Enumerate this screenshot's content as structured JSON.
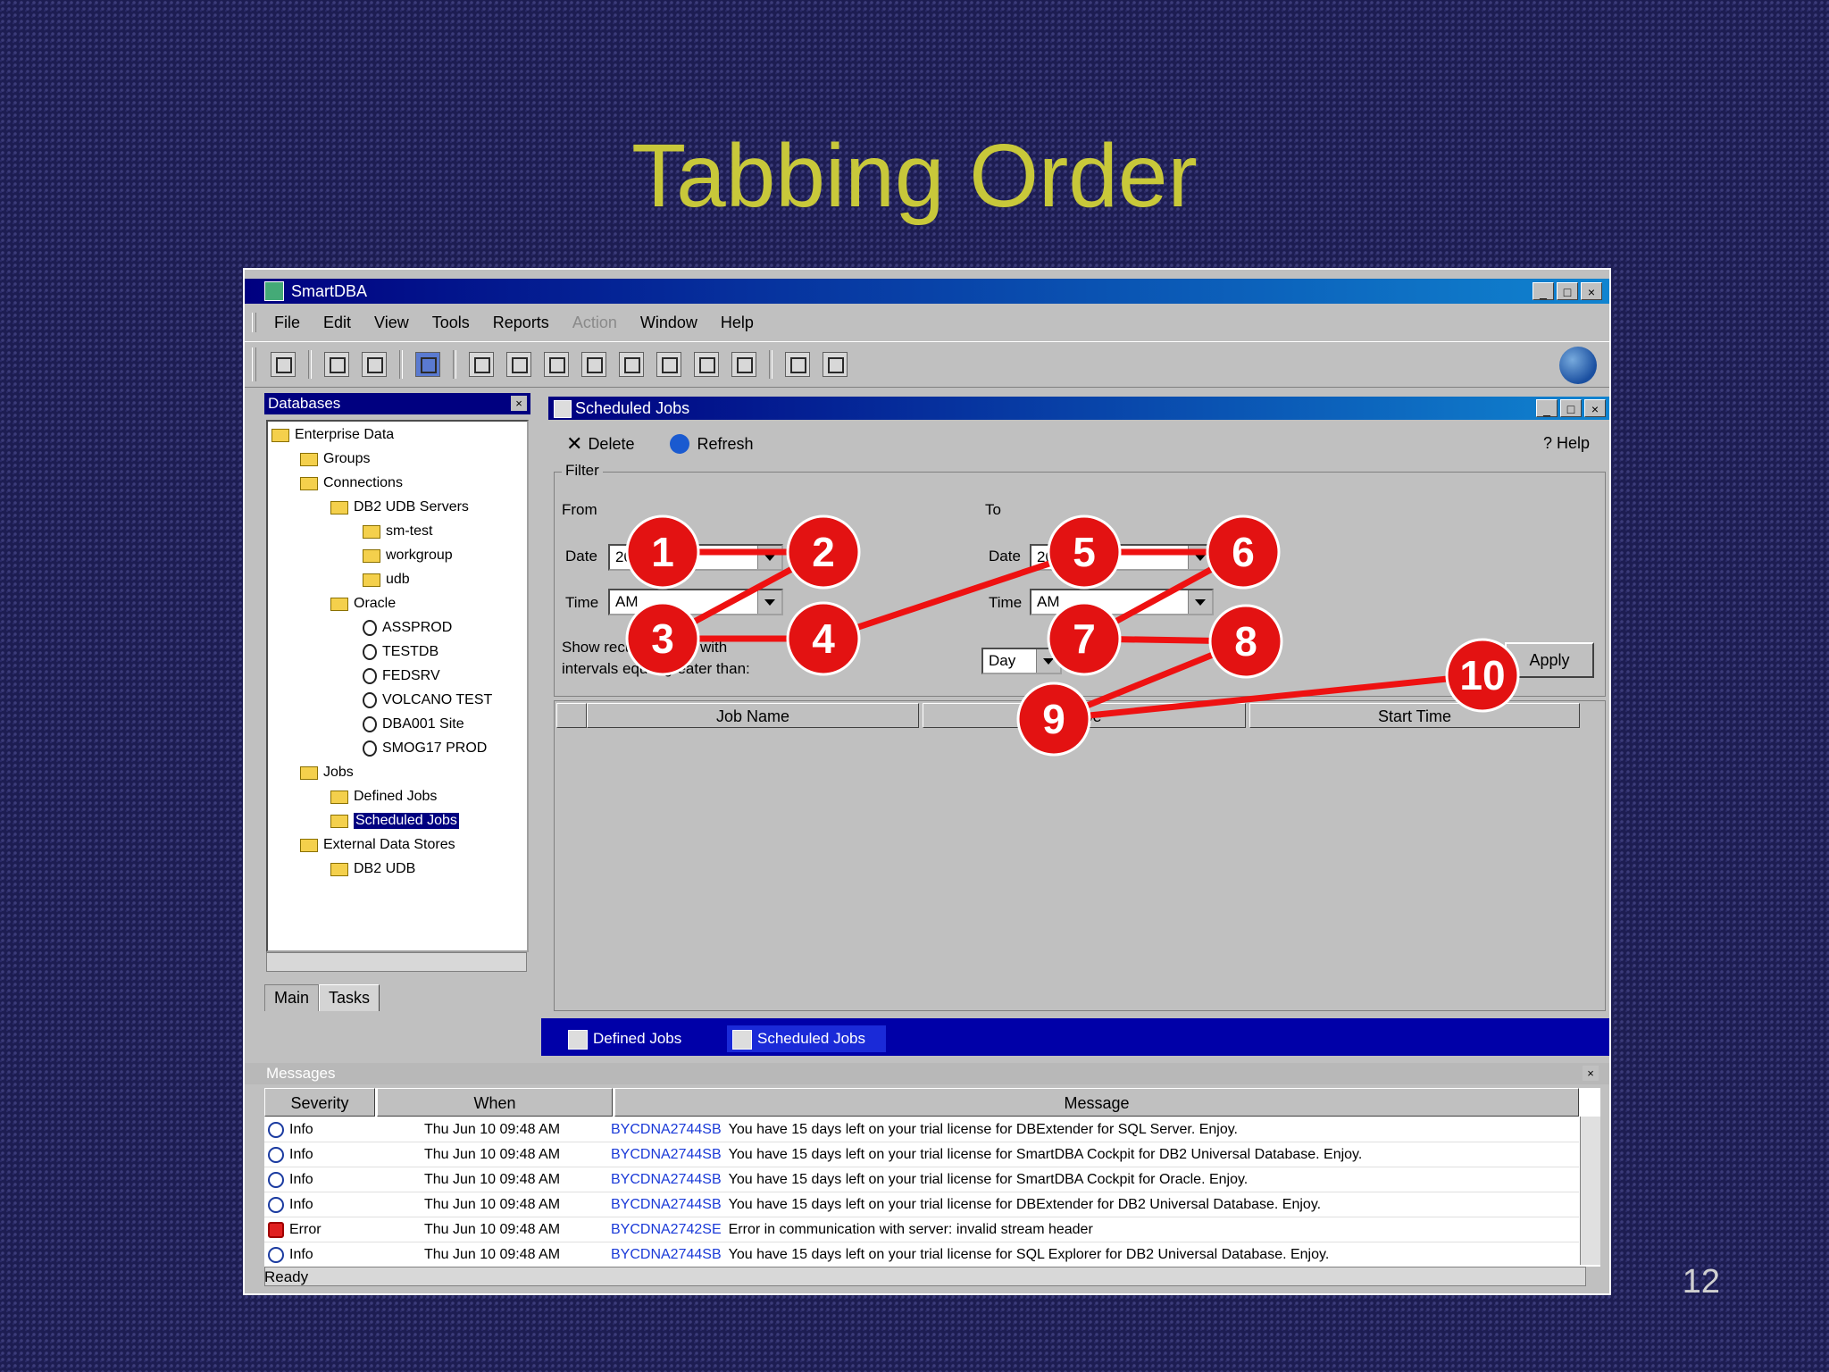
{
  "slide": {
    "title": "Tabbing Order",
    "page_number": "12"
  },
  "window": {
    "title": "SmartDBA",
    "min": "_",
    "max": "□",
    "close": "×"
  },
  "menu": [
    {
      "label": "File",
      "enabled": true
    },
    {
      "label": "Edit",
      "enabled": true
    },
    {
      "label": "View",
      "enabled": true
    },
    {
      "label": "Tools",
      "enabled": true
    },
    {
      "label": "Reports",
      "enabled": true
    },
    {
      "label": "Action",
      "enabled": false
    },
    {
      "label": "Window",
      "enabled": true
    },
    {
      "label": "Help",
      "enabled": true
    }
  ],
  "databases_panel": {
    "title": "Databases",
    "close": "×",
    "tree": [
      {
        "label": "Enterprise Data",
        "depth": 0,
        "icon": "folder"
      },
      {
        "label": "Groups",
        "depth": 1,
        "icon": "folder"
      },
      {
        "label": "Connections",
        "depth": 1,
        "icon": "folder"
      },
      {
        "label": "DB2 UDB Servers",
        "depth": 2,
        "icon": "folder"
      },
      {
        "label": "sm-test",
        "depth": 3,
        "icon": "folder"
      },
      {
        "label": "workgroup",
        "depth": 3,
        "icon": "folder"
      },
      {
        "label": "udb",
        "depth": 3,
        "icon": "folder"
      },
      {
        "label": "Oracle",
        "depth": 2,
        "icon": "folder"
      },
      {
        "label": "ASSPROD",
        "depth": 3,
        "icon": "node"
      },
      {
        "label": "TESTDB",
        "depth": 3,
        "icon": "node"
      },
      {
        "label": "FEDSRV",
        "depth": 3,
        "icon": "node"
      },
      {
        "label": "VOLCANO TEST",
        "depth": 3,
        "icon": "node"
      },
      {
        "label": "DBA001 Site",
        "depth": 3,
        "icon": "node"
      },
      {
        "label": "SMOG17 PROD",
        "depth": 3,
        "icon": "node"
      },
      {
        "label": "Jobs",
        "depth": 1,
        "icon": "folder"
      },
      {
        "label": "Defined Jobs",
        "depth": 2,
        "icon": "folder"
      },
      {
        "label": "Scheduled Jobs",
        "depth": 2,
        "icon": "folder",
        "selected": true
      },
      {
        "label": "External Data Stores",
        "depth": 1,
        "icon": "folder"
      },
      {
        "label": "DB2 UDB",
        "depth": 2,
        "icon": "folder"
      }
    ],
    "tabs": [
      {
        "label": "Main",
        "active": false
      },
      {
        "label": "Tasks",
        "active": true
      }
    ]
  },
  "scheduled_jobs": {
    "title": "Scheduled Jobs",
    "toolbar": {
      "delete_label": "Delete",
      "refresh_label": "Refresh",
      "help_label": "Help"
    },
    "filter": {
      "legend": "Filter",
      "from_label": "From",
      "to_label": "To",
      "date_label": "Date",
      "time_label": "Time",
      "from_date": "2004",
      "from_time": "AM",
      "to_date": "2004",
      "to_time": "AM",
      "interval_text_1": "Show recurring jobs with",
      "interval_text_2": "intervals equal/greater than:",
      "interval_value": "Day",
      "apply_label": "Apply"
    },
    "columns": [
      "",
      "Job Name",
      "Type",
      "Start Time"
    ]
  },
  "bottom_tabs": [
    {
      "label": "Defined Jobs",
      "active": false
    },
    {
      "label": "Scheduled Jobs",
      "active": true
    }
  ],
  "messages": {
    "title": "Messages",
    "close": "×",
    "columns": [
      "Severity",
      "When",
      "Message"
    ],
    "rows": [
      {
        "severity": "Info",
        "when": "Thu Jun 10 09:48 AM",
        "code": "BYCDNA2744SB",
        "text": "You have 15 days left on your trial license for DBExtender for SQL Server. Enjoy.",
        "error": false
      },
      {
        "severity": "Info",
        "when": "Thu Jun 10 09:48 AM",
        "code": "BYCDNA2744SB",
        "text": "You have 15 days left on your trial license for SmartDBA Cockpit for DB2 Universal Database. Enjoy.",
        "error": false
      },
      {
        "severity": "Info",
        "when": "Thu Jun 10 09:48 AM",
        "code": "BYCDNA2744SB",
        "text": "You have 15 days left on your trial license for SmartDBA Cockpit for Oracle. Enjoy.",
        "error": false
      },
      {
        "severity": "Info",
        "when": "Thu Jun 10 09:48 AM",
        "code": "BYCDNA2744SB",
        "text": "You have 15 days left on your trial license for DBExtender for DB2 Universal Database. Enjoy.",
        "error": false
      },
      {
        "severity": "Error",
        "when": "Thu Jun 10 09:48 AM",
        "code": "BYCDNA2742SE",
        "text": "Error in communication with server: invalid stream header",
        "error": true
      },
      {
        "severity": "Info",
        "when": "Thu Jun 10 09:48 AM",
        "code": "BYCDNA2744SB",
        "text": "You have 15 days left on your trial license for SQL Explorer for DB2 Universal Database. Enjoy.",
        "error": false
      }
    ]
  },
  "status": {
    "text": "Ready"
  },
  "tab_order_markers": [
    "1",
    "2",
    "3",
    "4",
    "5",
    "6",
    "7",
    "8",
    "9",
    "10"
  ]
}
